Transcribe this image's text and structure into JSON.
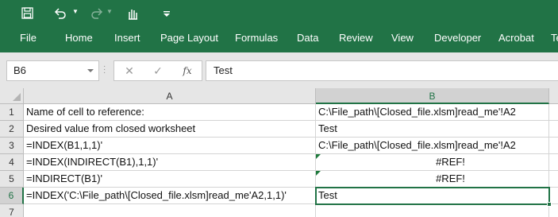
{
  "ribbon": {
    "tabs": [
      "File",
      "Home",
      "Insert",
      "Page Layout",
      "Formulas",
      "Data",
      "Review",
      "View",
      "Developer",
      "Acrobat",
      "Te"
    ]
  },
  "quick_access": {
    "icons": [
      "save-icon",
      "undo-icon",
      "redo-icon",
      "touch-mode-icon",
      "customize-qat-icon"
    ]
  },
  "formula_bar": {
    "name_box": "B6",
    "cancel_glyph": "✕",
    "enter_glyph": "✓",
    "fx_label": "fx",
    "formula": "Test"
  },
  "sheet": {
    "active_cell": "B6",
    "columns": [
      "A",
      "B"
    ],
    "rows": [
      {
        "num": "1",
        "a": "Name of cell to reference:",
        "b": "C:\\File_path\\[Closed_file.xlsm]read_me'!A2"
      },
      {
        "num": "2",
        "a": "Desired value from closed worksheet",
        "b": "Test"
      },
      {
        "num": "3",
        "a": "=INDEX(B1,1,1)'",
        "b": "C:\\File_path\\[Closed_file.xlsm]read_me'!A2"
      },
      {
        "num": "4",
        "a": "=INDEX(INDIRECT(B1),1,1)'",
        "b": "#REF!"
      },
      {
        "num": "5",
        "a": "=INDIRECT(B1)'",
        "b": "#REF!"
      },
      {
        "num": "6",
        "a": "=INDEX('C:\\File_path\\[Closed_file.xlsm]read_me'A2,1,1)'",
        "b": "Test"
      },
      {
        "num": "7",
        "a": "",
        "b": ""
      }
    ]
  },
  "colors": {
    "ribbon": "#217346",
    "selection": "#217346",
    "error_marker": "#1e7a3c"
  }
}
